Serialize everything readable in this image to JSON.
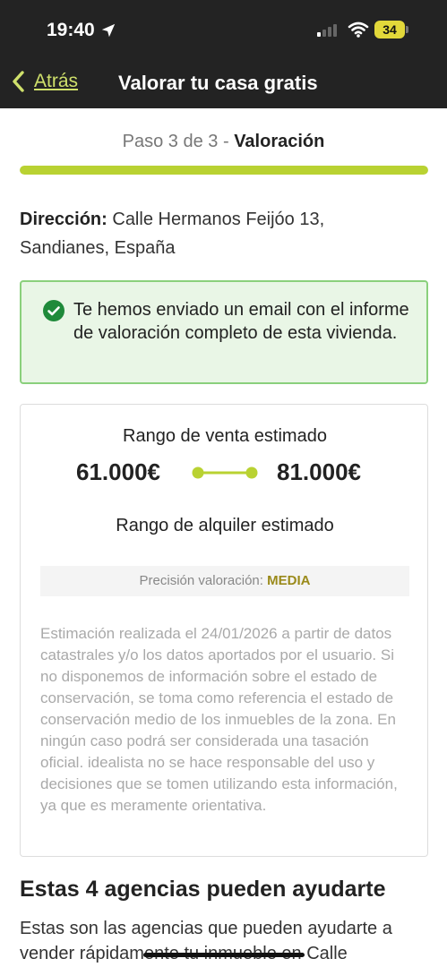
{
  "status": {
    "time": "19:40",
    "battery": "34"
  },
  "nav": {
    "back_label": "Atrás",
    "title": "Valorar tu casa gratis"
  },
  "step": {
    "prefix": "Paso 3 de 3 - ",
    "name": "Valoración",
    "progress_percent": 100,
    "accent_color": "#b9d232"
  },
  "address": {
    "label": "Dirección:",
    "value": " Calle Hermanos Feijóo 13, Sandianes, España"
  },
  "alert": {
    "text": "Te hemos enviado un email con el informe de valoración completo de esta vivienda."
  },
  "valuation": {
    "sale_title": "Rango de venta estimado",
    "sale_min": "61.000€",
    "sale_max": "81.000€",
    "rent_title": "Rango de alquiler estimado",
    "precision_label": "Precisión valoración: ",
    "precision_value": "MEDIA",
    "disclaimer": "Estimación realizada el 24/01/2026 a partir de datos catastrales y/o los datos aportados por el usuario. Si no disponemos de información sobre el estado de conservación, se toma como referencia el estado de conservación medio de los inmuebles de la zona. En ningún caso podrá ser considerada una tasación oficial. idealista no se hace responsable del uso y decisiones que se tomen utilizando esta información, ya que es meramente orientativa."
  },
  "agencies": {
    "title": "Estas 4 agencias pueden ayudarte",
    "text": "Estas son las agencias que pueden ayudarte a vender rápidamente tu inmueble en Calle"
  },
  "icons": {
    "location_arrow": "location-arrow-icon",
    "signal": "cellular-signal-icon",
    "wifi": "wifi-icon",
    "battery": "battery-icon",
    "back": "chevron-left-icon",
    "check": "check-circle-icon"
  }
}
